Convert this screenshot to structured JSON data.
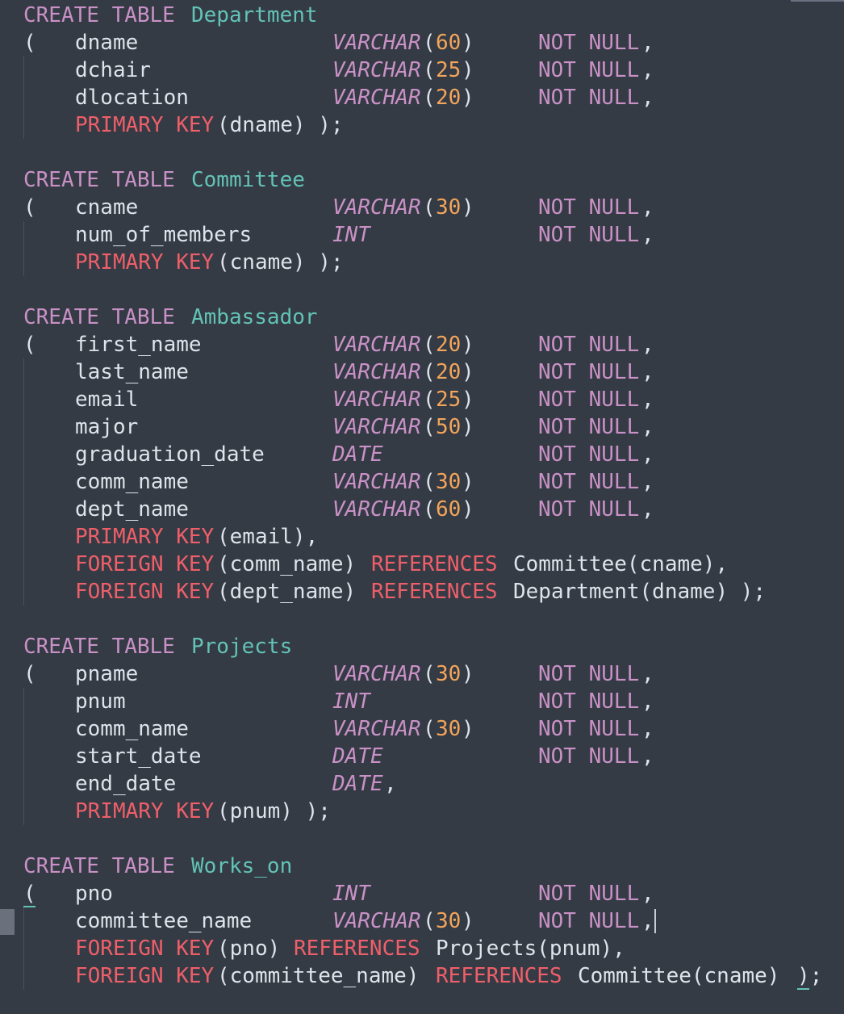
{
  "code": {
    "t1": {
      "create": "CREATE TABLE",
      "name": "Department",
      "c1": "dname",
      "c1_type": "VARCHAR",
      "c1_len": "60",
      "c2": "dchair",
      "c2_type": "VARCHAR",
      "c2_len": "25",
      "c3": "dlocation",
      "c3_type": "VARCHAR",
      "c3_len": "20",
      "pk": "PRIMARY KEY",
      "pk_arg": "(dname) );"
    },
    "t2": {
      "create": "CREATE TABLE",
      "name": "Committee",
      "c1": "cname",
      "c1_type": "VARCHAR",
      "c1_len": "30",
      "c2": "num_of_members",
      "c2_type": "INT",
      "pk": "PRIMARY KEY",
      "pk_arg": "(cname) );"
    },
    "t3": {
      "create": "CREATE TABLE",
      "name": "Ambassador",
      "c1": "first_name",
      "c1_type": "VARCHAR",
      "c1_len": "20",
      "c2": "last_name",
      "c2_type": "VARCHAR",
      "c2_len": "20",
      "c3": "email",
      "c3_type": "VARCHAR",
      "c3_len": "25",
      "c4": "major",
      "c4_type": "VARCHAR",
      "c4_len": "50",
      "c5": "graduation_date",
      "c5_type": "DATE",
      "c6": "comm_name",
      "c6_type": "VARCHAR",
      "c6_len": "30",
      "c7": "dept_name",
      "c7_type": "VARCHAR",
      "c7_len": "60",
      "pk": "PRIMARY KEY",
      "pk_arg": "(email),",
      "fk": "FOREIGN KEY",
      "ref": "REFERENCES",
      "fk1_arg": "(comm_name)",
      "fk1_target": "Committee(cname),",
      "fk2_arg": "(dept_name)",
      "fk2_target": "Department(dname) );"
    },
    "t4": {
      "create": "CREATE TABLE",
      "name": "Projects",
      "c1": "pname",
      "c1_type": "VARCHAR",
      "c1_len": "30",
      "c2": "pnum",
      "c2_type": "INT",
      "c3": "comm_name",
      "c3_type": "VARCHAR",
      "c3_len": "30",
      "c4": "start_date",
      "c4_type": "DATE",
      "c5": "end_date",
      "c5_type": "DATE",
      "pk": "PRIMARY KEY",
      "pk_arg": "(pnum) );"
    },
    "t5": {
      "create": "CREATE TABLE",
      "name": "Works_on",
      "c1": "pno",
      "c1_type": "INT",
      "c2": "committee_name",
      "c2_type": "VARCHAR",
      "c2_len": "30",
      "fk": "FOREIGN KEY",
      "ref": "REFERENCES",
      "fk1_arg": "(pno)",
      "fk1_target": "Projects(pnum),",
      "fk2_arg": "(committee_name)",
      "fk2_target": "Committee(cname)",
      "close": ");"
    },
    "open_paren": "(",
    "not_null": "NOT NULL",
    "comma": ",",
    "lparen": "(",
    "rparen": ")"
  },
  "colors": {
    "background": "#343b45",
    "keyword": "#c991c6",
    "table_name": "#63c3b7",
    "type": "#c991c6",
    "number": "#f3a55a",
    "constraint": "#ee5f69",
    "text": "#dfe3ea"
  }
}
